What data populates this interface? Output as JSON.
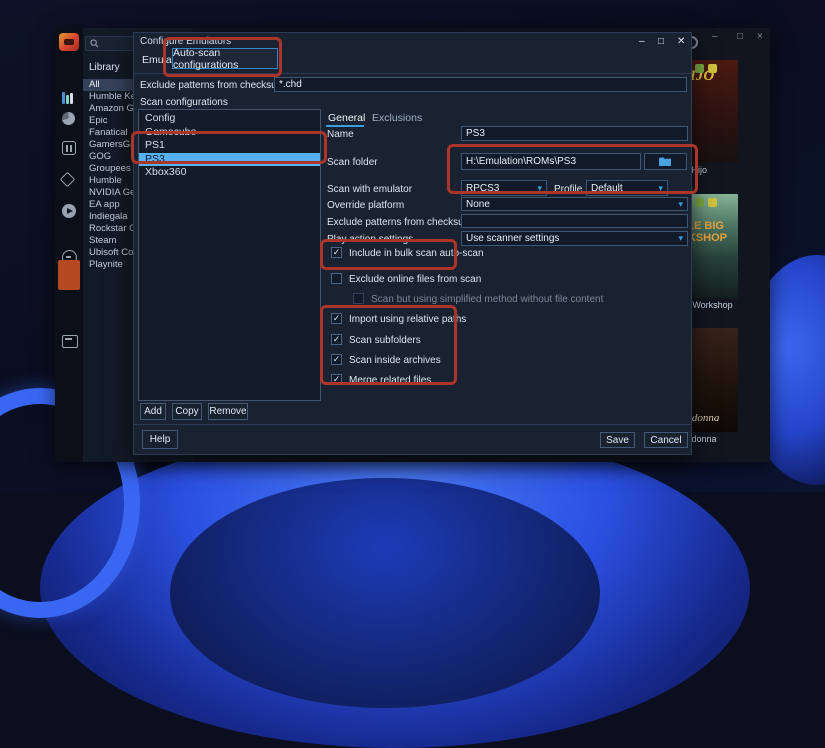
{
  "colors": {
    "accent": "#38a0e0",
    "selection": "#57b2f2",
    "annotation": "#ab3529",
    "logo_orange": "#d8432f"
  },
  "icons": {
    "check": "✓",
    "caret": "▾",
    "minimize": "–",
    "maximize": "□",
    "close": "×",
    "close_x": "✕"
  },
  "main_window": {
    "controls": {
      "minimize": "–",
      "maximize": "□",
      "close": "×"
    },
    "sidebar_filter": {
      "header": "Library",
      "selected": "All",
      "items": [
        "All",
        "Humble Keys",
        "Amazon Games",
        "Epic",
        "Fanatical",
        "GamersGate",
        "GOG",
        "Groupees",
        "Humble",
        "NVIDIA GeForce",
        "EA app",
        "Indiegala",
        "Rockstar Games",
        "Steam",
        "Ubisoft Connect",
        "Playnite"
      ]
    },
    "games": [
      {
        "title": "El Hijo",
        "cover_text": "EL HIJO"
      },
      {
        "title": "Little Big Workshop",
        "cover_text": "LITTLE BIG WORKSHOP"
      },
      {
        "title": "Belladonna",
        "cover_text": "Belladonna"
      }
    ]
  },
  "dialog": {
    "title": "Configure Emulators",
    "controls": {
      "minimize": "–",
      "maximize": "□",
      "close": "✕"
    },
    "tabs": {
      "emulators": "Emulators",
      "autoscan": "Auto-scan configurations"
    },
    "exclude_patterns": {
      "label": "Exclude patterns from checksum scan",
      "value": "*.chd"
    },
    "scan_configurations_label": "Scan configurations",
    "config_list": {
      "items": [
        "Config",
        "Gamecube",
        "PS1",
        "PS3",
        "Xbox360"
      ],
      "selected": "PS3"
    },
    "list_buttons": {
      "add": "Add",
      "copy": "Copy",
      "remove": "Remove"
    },
    "detail_tabs": {
      "general": "General",
      "exclusions": "Exclusions"
    },
    "form": {
      "name": {
        "label": "Name",
        "value": "PS3"
      },
      "scan_folder": {
        "label": "Scan folder",
        "value": "H:\\Emulation\\ROMs\\PS3"
      },
      "scan_with_emulator": {
        "label": "Scan with emulator",
        "value": "RPCS3"
      },
      "profile": {
        "label": "Profile",
        "value": "Default"
      },
      "override_platform": {
        "label": "Override platform",
        "value": "None"
      },
      "exclude_checksum": {
        "label": "Exclude patterns from checksum scan",
        "value": ""
      },
      "play_action": {
        "label": "Play action settings",
        "value": "Use scanner settings"
      }
    },
    "checkboxes": [
      {
        "label": "Include in bulk scan auto-scan",
        "checked": true
      },
      {
        "label": "Exclude online files from scan",
        "checked": false
      },
      {
        "label": "Scan but using simplified method without file content",
        "checked": false
      },
      {
        "label": "Import using relative paths",
        "checked": true
      },
      {
        "label": "Scan subfolders",
        "checked": true
      },
      {
        "label": "Scan inside archives",
        "checked": true
      },
      {
        "label": "Merge related files",
        "checked": true
      }
    ],
    "footer": {
      "help": "Help",
      "save": "Save",
      "cancel": "Cancel"
    }
  }
}
